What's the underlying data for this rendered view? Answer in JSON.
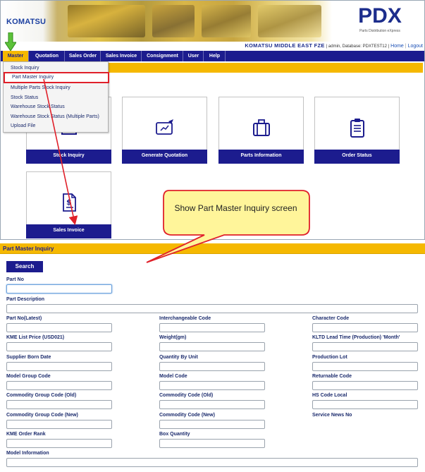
{
  "header": {
    "logo": "KOMATSU",
    "product": "PDX",
    "product_subtitle": "Parts Distribution eXpress",
    "company": "KOMATSU MIDDLE EAST FZE",
    "user_info": "| admin, Database: PDXTEST12 |",
    "home_link": "Home",
    "logout_link": "Logout"
  },
  "nav": {
    "items": [
      {
        "label": "Master"
      },
      {
        "label": "Quotation"
      },
      {
        "label": "Sales Order"
      },
      {
        "label": "Sales Invoice"
      },
      {
        "label": "Consignment"
      },
      {
        "label": "User"
      },
      {
        "label": "Help"
      }
    ]
  },
  "dropdown": {
    "items": [
      {
        "label": "Stock Inquiry"
      },
      {
        "label": "Part Master Inquiry"
      },
      {
        "label": "Multiple Parts Stock Inquiry"
      },
      {
        "label": "Stock Status"
      },
      {
        "label": "Warehouse Stock Status"
      },
      {
        "label": "Warehouse Stock Status (Multiple Parts)"
      },
      {
        "label": "Upload File"
      }
    ]
  },
  "tiles": [
    {
      "label": "Stock Inquiry",
      "icon": "inventory-icon"
    },
    {
      "label": "Generate Quotation",
      "icon": "tablet-pen-icon"
    },
    {
      "label": "Parts Information",
      "icon": "briefcase-icon"
    },
    {
      "label": "Order Status",
      "icon": "clipboard-icon"
    },
    {
      "label": "Sales Invoice",
      "icon": "invoice-dollar-icon"
    }
  ],
  "callout": {
    "text": "Show Part Master Inquiry screen"
  },
  "form": {
    "title": "Part Master Inquiry",
    "search_label": "Search",
    "fields": {
      "part_no": "Part No",
      "part_description": "Part Description",
      "part_no_latest": "Part No(Latest)",
      "interchangeable_code": "Interchangeable Code",
      "character_code": "Character Code",
      "kme_list_price": "KME List Price (USD021)",
      "weight": "Weight(gm)",
      "kltd_lead_time": "KLTD Lead Time (Production) 'Month'",
      "supplier_born_date": "Supplier Born Date",
      "quantity_by_unit": "Quantity By Unit",
      "production_lot": "Production Lot",
      "model_group_code": "Model Group Code",
      "model_code": "Model Code",
      "returnable_code": "Returnable Code",
      "commodity_group_code_old": "Commodity Group Code (Old)",
      "commodity_code_old": "Commodity Code (Old)",
      "hs_code_local": "HS Code Local",
      "commodity_group_code_new": "Commodity Group Code (New)",
      "commodity_code_new": "Commodity Code (New)",
      "service_news_no": "Service News No",
      "kme_order_rank": "KME Order Rank",
      "box_quantity": "Box Quantity",
      "model_information": "Model Information"
    }
  },
  "colors": {
    "navy": "#1c1c8e",
    "yellow": "#f5b800",
    "highlight_red": "#e0202a",
    "callout_fill": "#fff59a",
    "arrow_green": "#5cc23a"
  }
}
